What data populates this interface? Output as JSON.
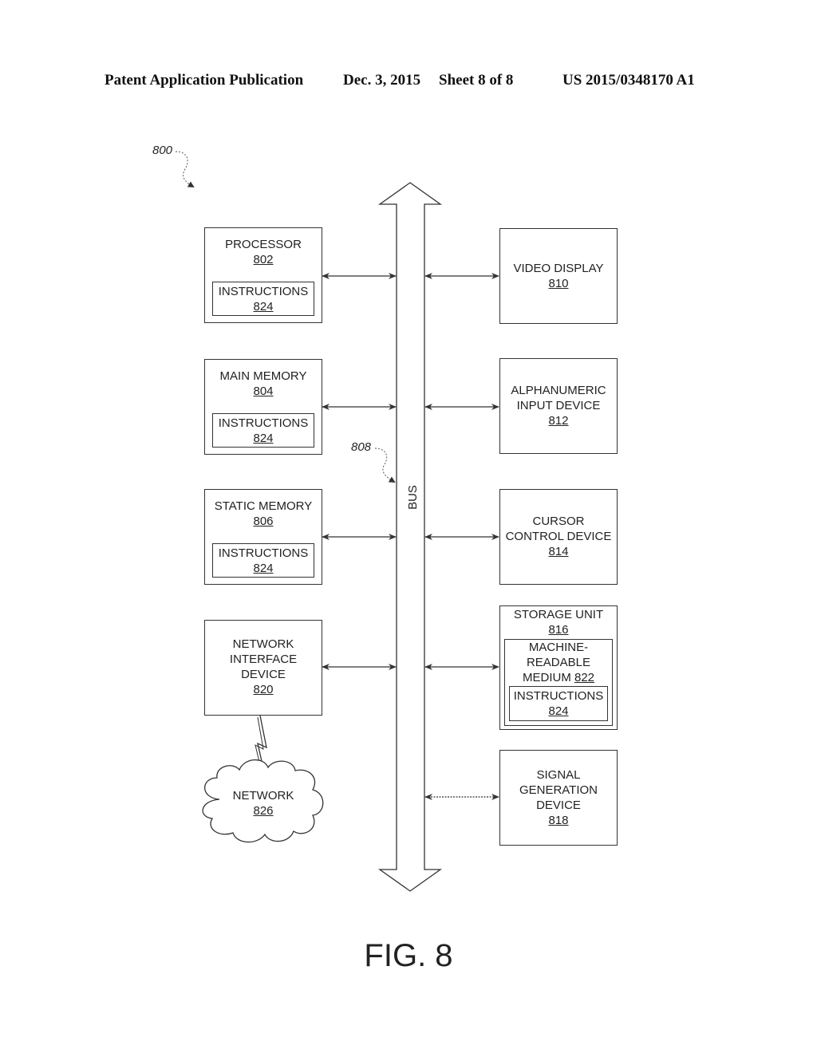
{
  "header": {
    "publication": "Patent Application Publication",
    "date": "Dec. 3, 2015",
    "sheet": "Sheet 8 of 8",
    "number": "US 2015/0348170 A1"
  },
  "figure": {
    "ref": "800",
    "caption": "FIG. 8",
    "bus": {
      "label": "BUS",
      "ref": "808"
    },
    "left_components": [
      {
        "title": "PROCESSOR",
        "ref": "802",
        "inner": {
          "title": "INSTRUCTIONS",
          "ref": "824"
        }
      },
      {
        "title": "MAIN MEMORY",
        "ref": "804",
        "inner": {
          "title": "INSTRUCTIONS",
          "ref": "824"
        }
      },
      {
        "title": "STATIC MEMORY",
        "ref": "806",
        "inner": {
          "title": "INSTRUCTIONS",
          "ref": "824"
        }
      },
      {
        "title_lines": [
          "NETWORK",
          "INTERFACE",
          "DEVICE"
        ],
        "ref": "820"
      }
    ],
    "network": {
      "title": "NETWORK",
      "ref": "826"
    },
    "right_components": [
      {
        "title": "VIDEO DISPLAY",
        "ref": "810"
      },
      {
        "title_lines": [
          "ALPHANUMERIC",
          "INPUT DEVICE"
        ],
        "ref": "812"
      },
      {
        "title_lines": [
          "CURSOR",
          "CONTROL DEVICE"
        ],
        "ref": "814"
      },
      {
        "title": "STORAGE UNIT",
        "ref": "816",
        "medium": {
          "title_lines": [
            "MACHINE-",
            "READABLE",
            "MEDIUM"
          ],
          "ref": "822"
        },
        "inner": {
          "title": "INSTRUCTIONS",
          "ref": "824"
        }
      },
      {
        "title_lines": [
          "SIGNAL",
          "GENERATION",
          "DEVICE"
        ],
        "ref": "818"
      }
    ]
  }
}
